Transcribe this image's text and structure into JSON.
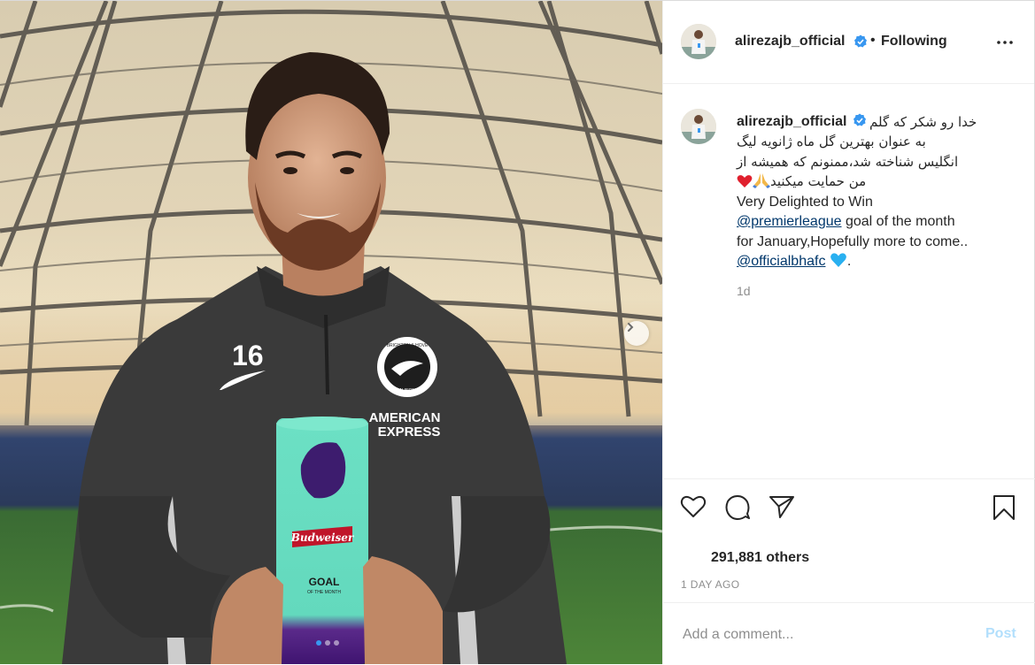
{
  "post": {
    "username": "alirezajb_official",
    "follow_bullet": "•",
    "follow_status": "Following",
    "more_icon": "more-dots-icon",
    "verified_icon": "verified-badge-icon",
    "verified_color": "#3897f0"
  },
  "media": {
    "shirt_number": "16",
    "club_badge_top": "BRIGHTON & HOVE",
    "club_badge_bottom": "ALBION",
    "sponsor_line1": "AMERICAN",
    "sponsor_line2": "EXPRESS",
    "trophy_brand": "Budweiser",
    "trophy_title": "GOAL",
    "trophy_subtitle": "OF THE MONTH",
    "carousel_count": 3,
    "carousel_active": 1,
    "next_icon": "chevron-right-icon"
  },
  "caption": {
    "line_fa_1": "خدا رو شکر که گلم",
    "line_fa_2": "به عنوان بهترین گل ماه ژانویه لیگ",
    "line_fa_3": "انگلیس شناخته شد،ممنونم که همیشه از",
    "line_fa_4": "من حمایت میکنید",
    "line_en_1": "Very Delighted to Win",
    "mention_1": "@premierleague",
    "line_en_2": " goal of the month",
    "line_en_3": "for January,Hopefully more to come..",
    "mention_2": "@officialbhafc",
    "line_en_end": ".",
    "time_ago": "1d"
  },
  "actions": {
    "like_icon": "heart-icon",
    "comment_icon": "comment-icon",
    "share_icon": "paper-plane-icon",
    "save_icon": "bookmark-icon"
  },
  "likes": {
    "text": "291,881 others"
  },
  "date": {
    "text": "1 DAY AGO"
  },
  "comment": {
    "placeholder": "Add a comment...",
    "post_label": "Post"
  }
}
